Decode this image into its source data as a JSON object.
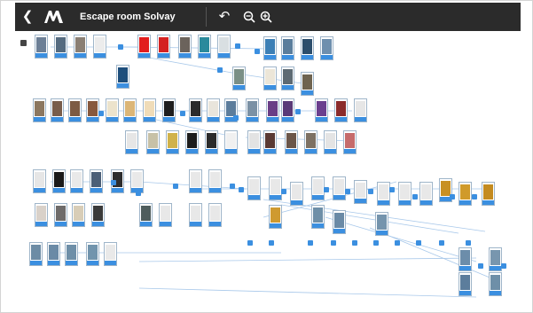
{
  "app": {
    "title": "Escape room Solvay",
    "back_icon": "chevron-left-icon",
    "logo_icon": "m-logo-icon",
    "undo_icon": "undo-icon",
    "zoom_out_icon": "zoom-out-icon",
    "zoom_in_icon": "zoom-in-icon"
  },
  "colors": {
    "topbar": "#2b2b2b",
    "accent": "#3b8fe0",
    "connector": "#3b8fe0",
    "line": "#a8c8ea"
  },
  "cards": [
    {
      "c": "#6c7f96"
    },
    {
      "c": "#556b80"
    },
    {
      "c": "#8a7f74"
    },
    {
      "c": "#ececec"
    },
    {
      "c": "#e21d1d"
    },
    {
      "c": "#d42222"
    },
    {
      "c": "#6b635c"
    },
    {
      "c": "#2a8a9c"
    },
    {
      "c": "#d9dfe2"
    },
    {
      "c": "#3c7fb5"
    },
    {
      "c": "#5a7d9c"
    },
    {
      "c": "#2c4e6c"
    },
    {
      "c": "#6e8fae"
    },
    {
      "c": "#1d4e7c"
    },
    {
      "c": "#7a8f86"
    },
    {
      "c": "#ece6d8"
    },
    {
      "c": "#5d6a73"
    },
    {
      "c": "#6f6450"
    },
    {
      "c": "#8c775f"
    },
    {
      "c": "#785d4b"
    },
    {
      "c": "#7d5b43"
    },
    {
      "c": "#87593e"
    },
    {
      "c": "#ece3cc"
    },
    {
      "c": "#dcb677"
    },
    {
      "c": "#f0dcb8"
    },
    {
      "c": "#1e1e1e"
    },
    {
      "c": "#2b2b2b"
    },
    {
      "c": "#e9e5dc"
    },
    {
      "c": "#5c7d9c"
    },
    {
      "c": "#7b91a5"
    },
    {
      "c": "#6a3e86"
    },
    {
      "c": "#5a3a78"
    },
    {
      "c": "#6b3f8e"
    },
    {
      "c": "#8b2b2b"
    },
    {
      "c": "#e6e6e6"
    },
    {
      "c": "#e6e6e6"
    },
    {
      "c": "#c7c1a7"
    },
    {
      "c": "#d0b24a"
    },
    {
      "c": "#1d1d1d"
    },
    {
      "c": "#2b2b2b"
    },
    {
      "c": "#f0f0f0"
    },
    {
      "c": "#e3e3e3"
    },
    {
      "c": "#5a3a34"
    },
    {
      "c": "#6b5649"
    },
    {
      "c": "#7d7163"
    },
    {
      "c": "#e4e4e4"
    },
    {
      "c": "#c66b6b"
    },
    {
      "c": "#e6e6e6"
    },
    {
      "c": "#1a1a1a"
    },
    {
      "c": "#e9e9e9"
    },
    {
      "c": "#4b5f77"
    },
    {
      "c": "#2d2d2d"
    },
    {
      "c": "#e9e9e9"
    },
    {
      "c": "#d9d1c9"
    },
    {
      "c": "#6e6b6a"
    },
    {
      "c": "#d8cdb7"
    },
    {
      "c": "#3a3a3a"
    },
    {
      "c": "#4f5d5d"
    },
    {
      "c": "#e8e8e8"
    },
    {
      "c": "#e8e8e8"
    },
    {
      "c": "#e8e8e8"
    },
    {
      "c": "#e8e8e8"
    },
    {
      "c": "#e8e8e8"
    },
    {
      "c": "#e8e8e8"
    },
    {
      "c": "#e8e8e8"
    },
    {
      "c": "#e8e8e8"
    },
    {
      "c": "#e8e8e8"
    },
    {
      "c": "#e8e8e8"
    },
    {
      "c": "#e8e8e8"
    },
    {
      "c": "#e8e8e8"
    },
    {
      "c": "#e8e8e8"
    },
    {
      "c": "#e8e8e8"
    },
    {
      "c": "#c89024"
    },
    {
      "c": "#d09a2a"
    },
    {
      "c": "#c48b20"
    },
    {
      "c": "#cf9a30"
    },
    {
      "c": "#6e8fa8"
    },
    {
      "c": "#6a8aa6"
    },
    {
      "c": "#7594ad"
    },
    {
      "c": "#6c8daa"
    },
    {
      "c": "#7896ae"
    },
    {
      "c": "#5c7d9c"
    },
    {
      "c": "#6e8fa8"
    },
    {
      "c": "#6d8ca5"
    },
    {
      "c": "#6a8aa6"
    },
    {
      "c": "#6e8fa8"
    },
    {
      "c": "#7194ad"
    },
    {
      "c": "#e9e9e9"
    }
  ]
}
